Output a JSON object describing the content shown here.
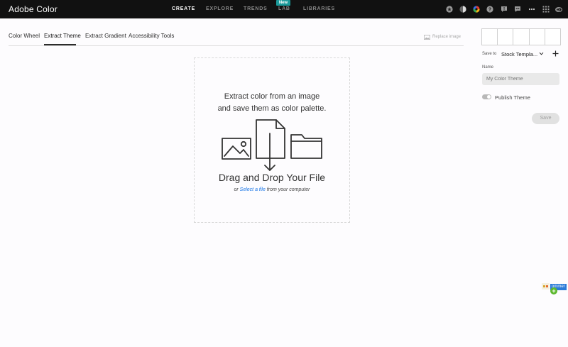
{
  "header": {
    "brand": "Adobe Color",
    "nav": [
      {
        "label": "CREATE",
        "active": true
      },
      {
        "label": "EXPLORE",
        "active": false
      },
      {
        "label": "TRENDS",
        "active": false
      },
      {
        "label": "LAB",
        "active": false
      },
      {
        "label": "LIBRARIES",
        "active": false
      }
    ],
    "new_badge": "New",
    "icons": [
      "star-icon",
      "contrast-icon",
      "color-wheel-icon",
      "help-icon",
      "feedback-icon",
      "chat-icon",
      "more-icon",
      "apps-grid-icon",
      "creative-cloud-icon"
    ]
  },
  "tabs": [
    {
      "label": "Color Wheel",
      "active": false
    },
    {
      "label": "Extract Theme",
      "active": true
    },
    {
      "label": "Extract Gradient",
      "active": false
    },
    {
      "label": "Accessibility Tools",
      "active": false
    }
  ],
  "replace_image": "Replace image",
  "dropzone": {
    "line1": "Extract color from an image",
    "line2": "and save them as color palette.",
    "title": "Drag and Drop Your File",
    "sub_prefix": "or ",
    "sub_link": "Select a file",
    "sub_suffix": " from your computer"
  },
  "panel": {
    "swatch_colors": [
      "#ffffff",
      "#ffffff",
      "#ffffff",
      "#ffffff",
      "#ffffff"
    ],
    "save_to_label": "Save to",
    "save_to_value": "Stock Templa...",
    "name_label": "Name",
    "name_placeholder": "My Color Theme",
    "publish_label": "Publish Theme",
    "save_button": "Save"
  },
  "extension": {
    "label": "ommer"
  },
  "colors": {
    "accent_link": "#1473e6",
    "topbar_bg": "#111111",
    "badge_bg": "#1b9a9a"
  }
}
